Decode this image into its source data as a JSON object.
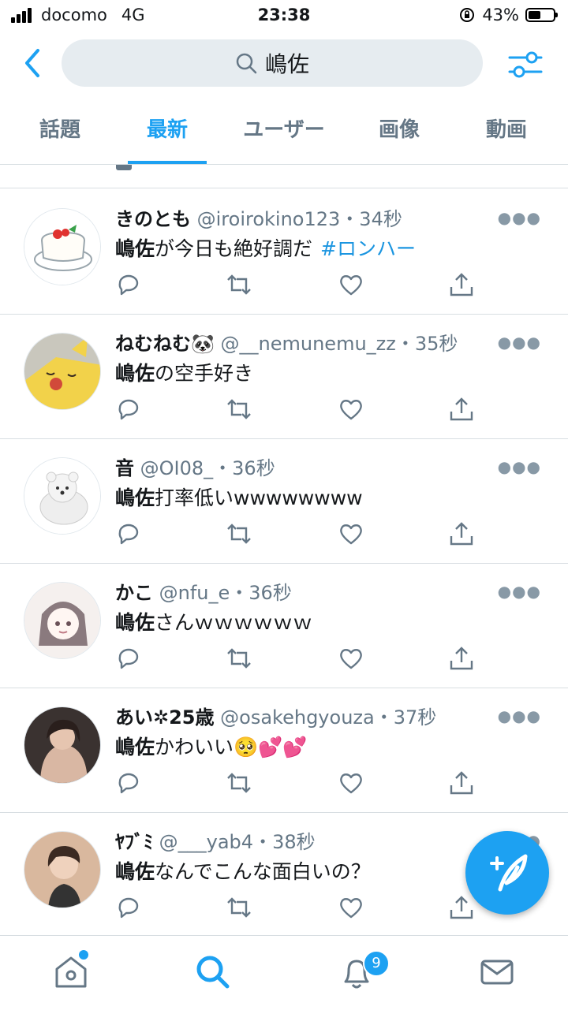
{
  "status_bar": {
    "carrier": "docomo",
    "network": "4G",
    "time": "23:38",
    "battery": "43%",
    "battery_level": 0.43
  },
  "search": {
    "query": "嶋佐"
  },
  "tabs": [
    {
      "label": "話題",
      "active": false
    },
    {
      "label": "最新",
      "active": true
    },
    {
      "label": "ユーザー",
      "active": false
    },
    {
      "label": "画像",
      "active": false
    },
    {
      "label": "動画",
      "active": false
    }
  ],
  "tweets": [
    {
      "name": "きのとも",
      "handle": "@iroirokino123",
      "time": "34秒",
      "keyword": "嶋佐",
      "text": "が今日も絶好調だ",
      "hashtag": "#ロンハー"
    },
    {
      "name": "ねむねむ🐼",
      "handle": "@__nemunemu_zz",
      "time": "35秒",
      "keyword": "嶋佐",
      "text": "の空手好き"
    },
    {
      "name": "音",
      "handle": "@OI08_",
      "time": "36秒",
      "keyword": "嶋佐",
      "text": "打率低いwwwwwwww"
    },
    {
      "name": "かこ",
      "handle": "@nfu_e",
      "time": "36秒",
      "keyword": "嶋佐",
      "text": "さんｗｗｗｗｗｗ"
    },
    {
      "name": "あい✲25歳",
      "handle": "@osakehgyouza",
      "time": "37秒",
      "keyword": "嶋佐",
      "text": "かわいい🥺💕💕"
    },
    {
      "name": "ﾔﾌﾞﾐ",
      "handle": "@___yab4",
      "time": "38秒",
      "keyword": "嶋佐",
      "text": "なんでこんな面白いの？"
    }
  ],
  "bottom_nav": {
    "notifications_badge": "9"
  },
  "icons": {
    "back": "chevron-left-icon",
    "filter": "sliders-icon",
    "compose": "compose-feather-icon"
  },
  "colors": {
    "accent": "#1da1f2",
    "hashtag": "#1b95e0",
    "secondary": "#657786"
  }
}
